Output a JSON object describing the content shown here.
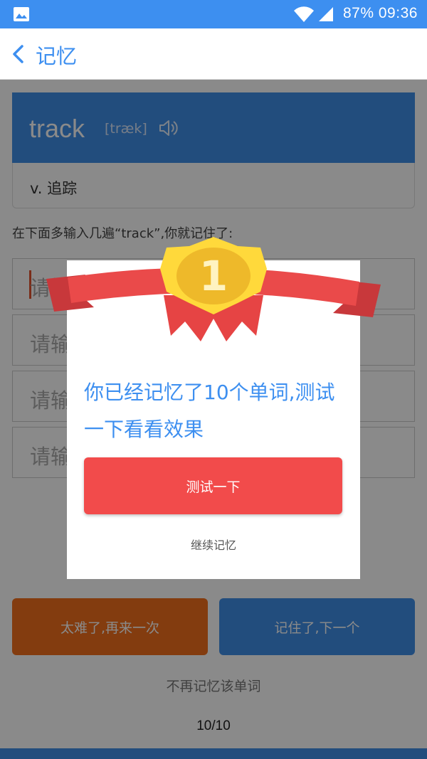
{
  "status_bar": {
    "battery": "87%",
    "time": "09:36",
    "icons": [
      "image-icon",
      "wifi-icon",
      "signal-icon"
    ]
  },
  "app_bar": {
    "title": "记忆",
    "back_icon": "chevron-left-icon"
  },
  "word": {
    "text": "track",
    "phonetic": "[træk]",
    "speaker_icon": "speaker-icon",
    "meaning": "v. 追踪"
  },
  "practice": {
    "hint": "在下面多输入几遍“track”,你就记住了:",
    "input_placeholder": "请输入单词"
  },
  "actions": {
    "too_hard": "太难了,再来一次",
    "remembered": "记住了,下一个",
    "stop": "不再记忆该单词"
  },
  "progress": "10/10",
  "dialog": {
    "badge_number": "1",
    "message": "你已经记忆了10个单词,测试一下看看效果",
    "test_button": "测试一下",
    "continue_link": "继续记忆"
  },
  "colors": {
    "primary_blue": "#3d8ff0",
    "orange": "#f26f1c",
    "red": "#f24b4b",
    "gold": "#ffd93b"
  }
}
